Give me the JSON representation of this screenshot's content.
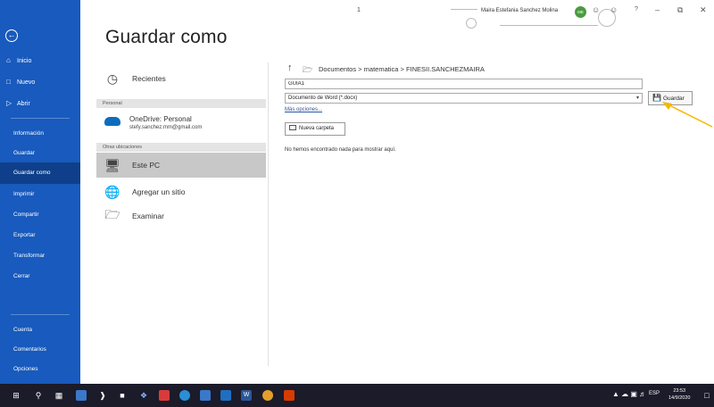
{
  "page_title": "Guardar como",
  "topbar": {
    "counter": "1",
    "user_name": "Maira Estefania Sanchez Molina",
    "avatar_initials": "ME",
    "help": "?"
  },
  "nav": {
    "items": [
      {
        "label": "Inicio",
        "icon": "home-icon"
      },
      {
        "label": "Nuevo",
        "icon": "new-doc-icon"
      },
      {
        "label": "Abrir",
        "icon": "open-folder-icon"
      },
      {
        "label": "Información"
      },
      {
        "label": "Guardar"
      },
      {
        "label": "Guardar como"
      },
      {
        "label": "Imprimir"
      },
      {
        "label": "Compartir"
      },
      {
        "label": "Exportar"
      },
      {
        "label": "Transformar"
      },
      {
        "label": "Cerrar"
      },
      {
        "label": "Cuenta"
      },
      {
        "label": "Comentarios"
      },
      {
        "label": "Opciones"
      }
    ]
  },
  "places": {
    "recent": "Recientes",
    "personal_header": "Personal",
    "onedrive_title": "OneDrive: Personal",
    "onedrive_email": "stefy.sanchez.mm@gmail.com",
    "other_header": "Otras ubicaciones",
    "this_pc": "Este PC",
    "add_site": "Agregar un sitio",
    "browse": "Examinar"
  },
  "save_panel": {
    "breadcrumb": "Documentos > matematica > FINESII.SANCHEZMAIRA",
    "filename": "GUIA1",
    "filetype": "Documento de Word (*.docx)",
    "more_options": "Más opciones...",
    "save_label": "Guardar",
    "new_folder": "Nueva carpeta",
    "empty_message": "No hemos encontrado nada para mostrar aquí."
  },
  "taskbar": {
    "language": "ESP",
    "time": "23:53",
    "date": "14/9/2020"
  },
  "colors": {
    "nav_bg": "#185abd",
    "accent": "#2b579a",
    "arrow": "#f5b800"
  }
}
